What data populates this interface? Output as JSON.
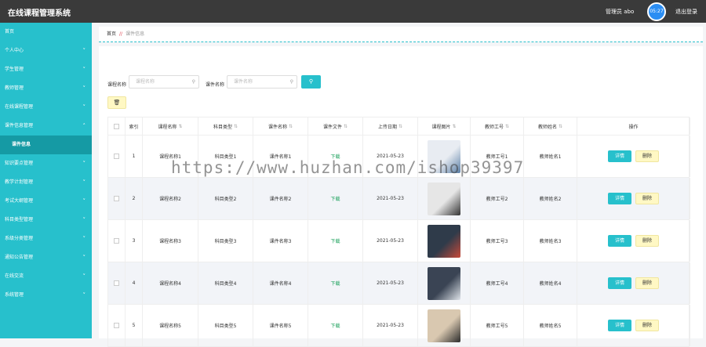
{
  "header": {
    "app_title": "在线课程管理系统",
    "admin_label": "管理员 abo",
    "avatar_text": "05:27",
    "logout_label": "退出登录"
  },
  "sidebar": {
    "items": [
      {
        "label": "首页",
        "has_chevron": false
      },
      {
        "label": "个人中心",
        "has_chevron": true
      },
      {
        "label": "学生管理",
        "has_chevron": true
      },
      {
        "label": "教师管理",
        "has_chevron": true
      },
      {
        "label": "在线课程管理",
        "has_chevron": true
      },
      {
        "label": "课件信息管理",
        "has_chevron": true,
        "expanded": true
      },
      {
        "label": "课件信息",
        "sub": true
      },
      {
        "label": "知识要点管理",
        "has_chevron": true
      },
      {
        "label": "教学计划管理",
        "has_chevron": true
      },
      {
        "label": "考试大纲管理",
        "has_chevron": true
      },
      {
        "label": "科目类型管理",
        "has_chevron": true
      },
      {
        "label": "系级分类管理",
        "has_chevron": true
      },
      {
        "label": "通知公告管理",
        "has_chevron": true
      },
      {
        "label": "在线交流",
        "has_chevron": true
      },
      {
        "label": "系统管理",
        "has_chevron": true
      }
    ]
  },
  "breadcrumb": {
    "home": "首页",
    "separator": "//",
    "current": "课件信息"
  },
  "search": {
    "course_label": "课程名称",
    "course_placeholder": "课程名称",
    "file_label": "课件名称",
    "file_placeholder": "课件名称",
    "search_icon": "search-icon"
  },
  "toolbar": {
    "delete_icon": "trash-icon"
  },
  "table": {
    "columns": [
      "",
      "索引",
      "课程名称",
      "科目类型",
      "课件名称",
      "课件文件",
      "上传日期",
      "课程图片",
      "教师工号",
      "教师姓名",
      "操作"
    ],
    "rows": [
      {
        "index": "1",
        "course": "课程名称1",
        "subject": "科目类型1",
        "file_name": "课件名称1",
        "file": "下载",
        "date": "2021-05-23",
        "teacher_id": "教师工号1",
        "teacher_name": "教师姓名1"
      },
      {
        "index": "2",
        "course": "课程名称2",
        "subject": "科目类型2",
        "file_name": "课件名称2",
        "file": "下载",
        "date": "2021-05-23",
        "teacher_id": "教师工号2",
        "teacher_name": "教师姓名2"
      },
      {
        "index": "3",
        "course": "课程名称3",
        "subject": "科目类型3",
        "file_name": "课件名称3",
        "file": "下载",
        "date": "2021-05-23",
        "teacher_id": "教师工号3",
        "teacher_name": "教师姓名3"
      },
      {
        "index": "4",
        "course": "课程名称4",
        "subject": "科目类型4",
        "file_name": "课件名称4",
        "file": "下载",
        "date": "2021-05-23",
        "teacher_id": "教师工号4",
        "teacher_name": "教师姓名4"
      },
      {
        "index": "5",
        "course": "课程名称5",
        "subject": "科目类型5",
        "file_name": "课件名称5",
        "file": "下载",
        "date": "2021-05-23",
        "teacher_id": "教师工号5",
        "teacher_name": "教师姓名5"
      }
    ],
    "detail_label": "详情",
    "delete_label": "删除"
  },
  "watermark": "https://www.huzhan.com/ishop39397",
  "colors": {
    "accent": "#27c0cc",
    "topbar": "#3a3a3a",
    "sidebar": "#27c0cc",
    "sidebar_active": "#159aa4",
    "download": "#1aa05a",
    "warning_btn": "#fff8c4"
  }
}
